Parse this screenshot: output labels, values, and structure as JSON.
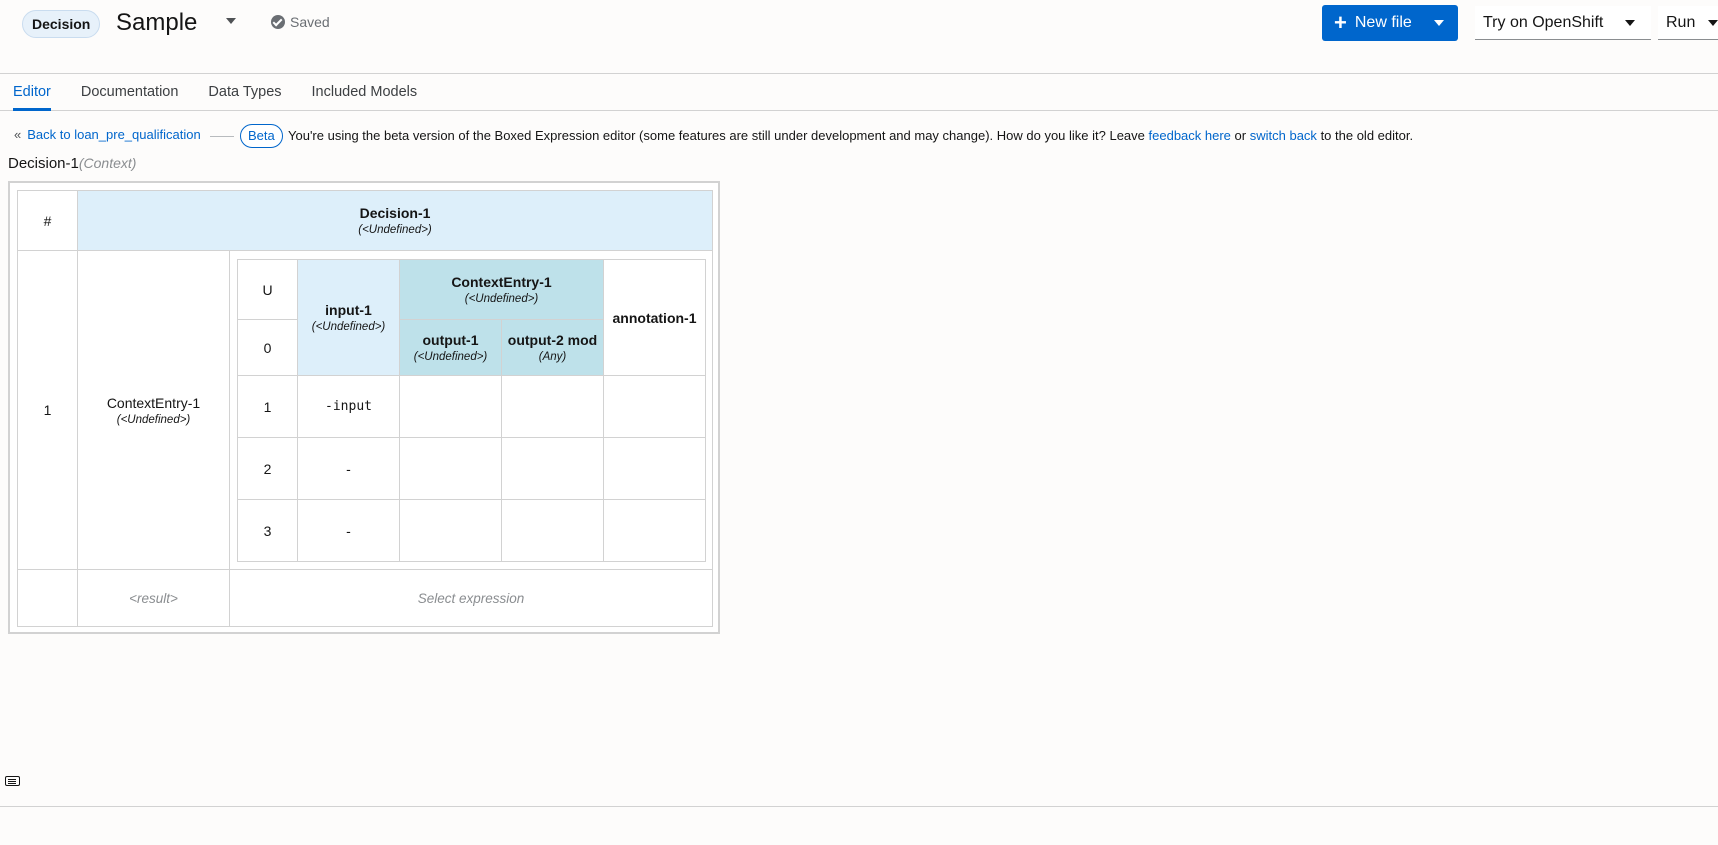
{
  "header": {
    "kind_badge": "Decision",
    "file_name": "Sample",
    "saved_label": "Saved",
    "new_file_label": "New file",
    "try_openshift_label": "Try on OpenShift",
    "run_label": "Run",
    "accent_color": "#0066cc"
  },
  "tabs": [
    "Editor",
    "Documentation",
    "Data Types",
    "Included Models"
  ],
  "beta_bar": {
    "back_link": "Back to loan_pre_qualification",
    "badge": "Beta",
    "message_start": "You're using the beta version of the Boxed Expression editor (some features are still under development and may change). How do you like it? Leave",
    "feedback_link": "feedback here",
    "middle": "or",
    "switch_link": "switch back",
    "message_end": "to the old editor."
  },
  "expression": {
    "name": "Decision-1",
    "kind": "(Context)"
  },
  "context_table": {
    "row_header": "#",
    "header_name": "Decision-1",
    "header_type": "(<Undefined>)",
    "row_number": "1",
    "entry_name": "ContextEntry-1",
    "entry_type": "(<Undefined>)",
    "result_label": "<result>",
    "result_placeholder": "Select expression"
  },
  "decision_table": {
    "hit_policy": "U",
    "hit_policy_row": "0",
    "input": {
      "name": "input-1",
      "type": "(<Undefined>)"
    },
    "output_group": {
      "name": "ContextEntry-1",
      "type": "(<Undefined>)"
    },
    "outputs": [
      {
        "name": "output-1",
        "type": "(<Undefined>)"
      },
      {
        "name": "output-2 mod",
        "type": "(Any)"
      }
    ],
    "annotation": "annotation-1",
    "rows": [
      {
        "n": "1",
        "input": "-input"
      },
      {
        "n": "2",
        "input": "-"
      },
      {
        "n": "3",
        "input": "-"
      }
    ]
  }
}
